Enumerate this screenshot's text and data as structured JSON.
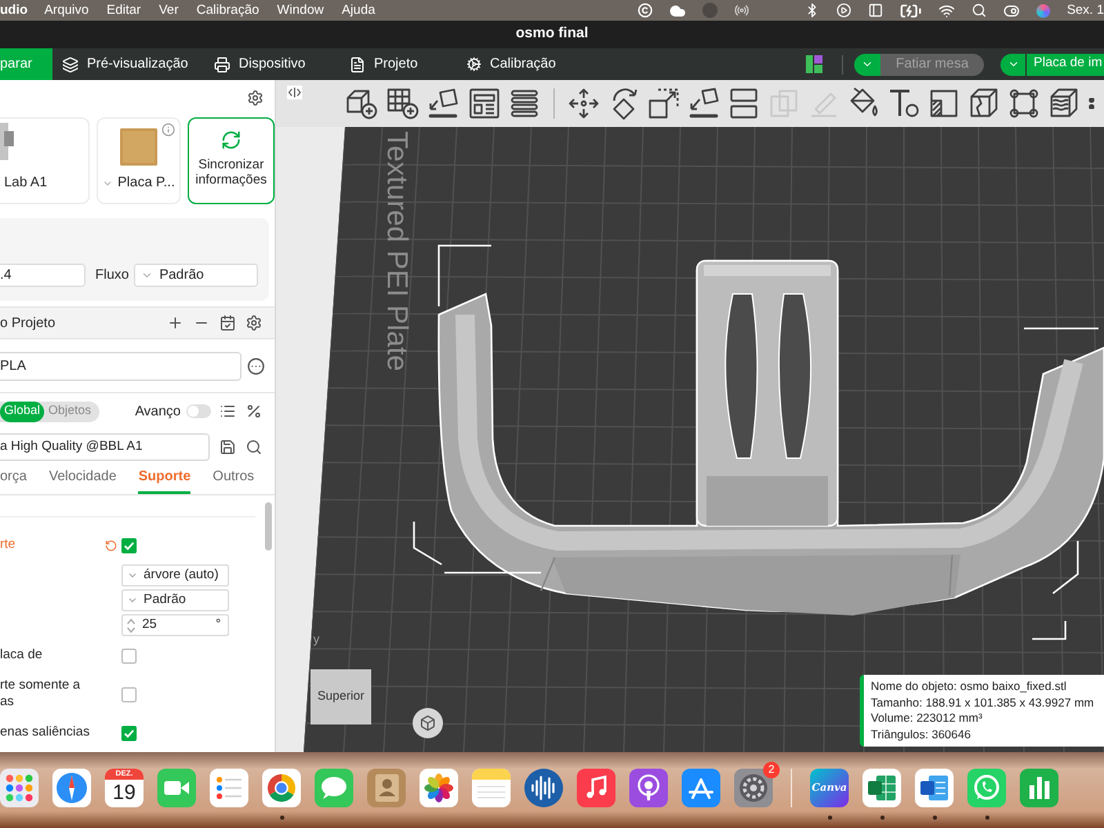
{
  "menu_bar": {
    "app": "udio",
    "menus": [
      "Arquivo",
      "Editar",
      "Ver",
      "Calibração",
      "Window",
      "Ajuda"
    ],
    "clock": "Sex. 1"
  },
  "window": {
    "title": "osmo final"
  },
  "top_tabs": [
    {
      "label": "parar",
      "selected": true
    },
    {
      "label": "Pré-visualização",
      "selected": false
    },
    {
      "label": "Dispositivo",
      "selected": false
    },
    {
      "label": "Projeto",
      "selected": false
    },
    {
      "label": "Calibração",
      "selected": false
    }
  ],
  "slice_button": {
    "label": "Fatiar mesa",
    "disabled": true
  },
  "print_button": {
    "label": "Placa de im",
    "disabled": false
  },
  "printer_cards": [
    {
      "kind": "printer",
      "label": "Lab A1"
    },
    {
      "kind": "plate",
      "label": "Placa P..."
    },
    {
      "kind": "sync",
      "label": "Sincronizar informações"
    }
  ],
  "extruder": {
    "nozzle": ".4",
    "flow_label": "Fluxo",
    "flow": "Padrão"
  },
  "filament": {
    "title": "o Projeto",
    "value": "PLA"
  },
  "process": {
    "scopes": [
      {
        "label": "Global",
        "selected": true
      },
      {
        "label": "Objetos",
        "selected": false
      }
    ],
    "advanced": {
      "label": "Avanço",
      "on": false
    },
    "preset": "a High Quality @BBL A1",
    "tabs": [
      {
        "label": "orça",
        "selected": false
      },
      {
        "label": "Velocidade",
        "selected": false
      },
      {
        "label": "Suporte",
        "selected": true
      },
      {
        "label": "Outros",
        "selected": false
      }
    ],
    "settings": [
      {
        "kind": "checkbox",
        "label": "rte",
        "checked": true,
        "modified": true
      },
      {
        "kind": "dropdown",
        "value": "árvore (auto)"
      },
      {
        "kind": "dropdown",
        "value": "Padrão"
      },
      {
        "kind": "spinner",
        "value": "25",
        "unit": "°"
      },
      {
        "kind": "checkbox",
        "label": "laca de",
        "checked": false,
        "modified": false
      },
      {
        "kind": "checkbox",
        "label": "rte somente a\nas",
        "checked": false,
        "modified": false
      },
      {
        "kind": "checkbox",
        "label": "enas saliências",
        "checked": true,
        "modified": false
      }
    ]
  },
  "viewport": {
    "tool_groups": [
      [
        {
          "kind": "addpart",
          "disabled": false
        },
        {
          "kind": "addplate",
          "disabled": false
        },
        {
          "kind": "orient",
          "disabled": false
        },
        {
          "kind": "arrange",
          "disabled": false
        },
        {
          "kind": "layers",
          "disabled": false
        }
      ],
      [
        {
          "kind": "move",
          "disabled": false
        },
        {
          "kind": "rotate",
          "disabled": false
        },
        {
          "kind": "scale",
          "disabled": false
        },
        {
          "kind": "lay",
          "disabled": false
        },
        {
          "kind": "split",
          "disabled": false
        },
        {
          "kind": "boolean",
          "disabled": true
        },
        {
          "kind": "measure",
          "disabled": true
        },
        {
          "kind": "paint",
          "disabled": false
        },
        {
          "kind": "text",
          "disabled": false
        },
        {
          "kind": "seam",
          "disabled": false
        },
        {
          "kind": "cut",
          "disabled": false
        },
        {
          "kind": "corners",
          "disabled": false
        },
        {
          "kind": "variable",
          "disabled": false
        },
        {
          "kind": "more",
          "disabled": false
        }
      ]
    ],
    "plate_label": "Textured PEI Plate",
    "axis_label": "y",
    "view_cube_label": "Superior",
    "object_info": [
      "Nome do objeto: osmo baixo_fixed.stl",
      "Tamanho: 188.91 x 101.385 x 43.9927 mm",
      "Volume: 223012 mm³",
      "Triângulos: 360646"
    ]
  },
  "dock": {
    "groups": [
      [
        {
          "kind": "apps",
          "running": false
        },
        {
          "kind": "compass",
          "running": false
        },
        {
          "kind": "calendar",
          "month": "DEZ.",
          "day": "19",
          "running": false
        },
        {
          "kind": "camera",
          "running": false
        },
        {
          "kind": "checklist",
          "running": false
        },
        {
          "kind": "chrome",
          "running": true
        },
        {
          "kind": "chat",
          "running": false
        },
        {
          "kind": "contacts",
          "running": false
        },
        {
          "kind": "photos",
          "running": false
        },
        {
          "kind": "notes",
          "running": false
        },
        {
          "kind": "waveform",
          "running": false
        },
        {
          "kind": "music",
          "running": false
        },
        {
          "kind": "podcasts",
          "running": false
        },
        {
          "kind": "store",
          "running": false
        },
        {
          "kind": "gear",
          "badge": "2",
          "running": false
        }
      ],
      [
        {
          "kind": "canva",
          "label": "Canva",
          "running": true
        },
        {
          "kind": "sheet",
          "running": true
        },
        {
          "kind": "doc",
          "running": true
        },
        {
          "kind": "phone",
          "running": true
        },
        {
          "kind": "bars",
          "running": false
        }
      ]
    ]
  }
}
